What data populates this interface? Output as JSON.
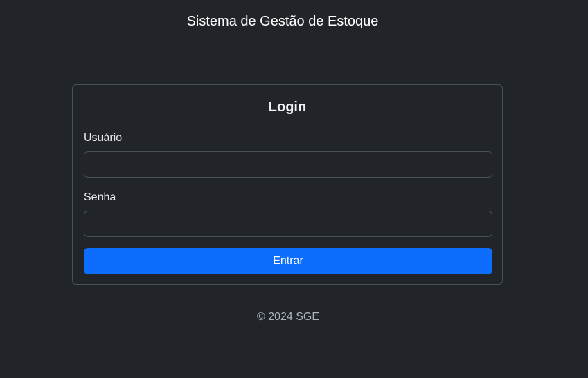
{
  "header": {
    "title": "Sistema de Gestão de Estoque"
  },
  "login": {
    "title": "Login",
    "username_label": "Usuário",
    "username_value": "",
    "password_label": "Senha",
    "password_value": "",
    "submit_label": "Entrar"
  },
  "footer": {
    "text": "© 2024 SGE"
  },
  "colors": {
    "background": "#212529",
    "primary": "#0d6efd",
    "border": "#495057"
  }
}
